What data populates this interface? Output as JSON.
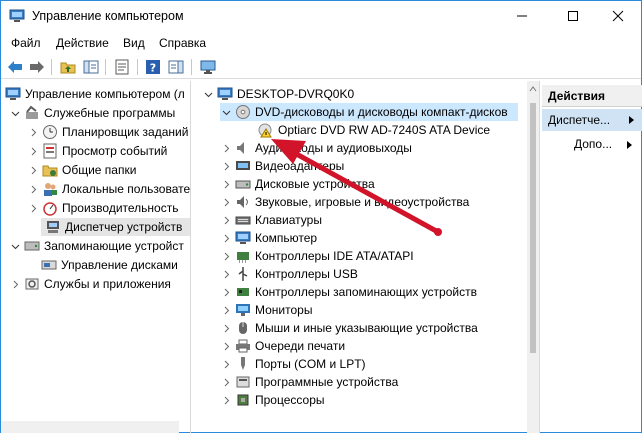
{
  "window": {
    "title": "Управление компьютером",
    "controls": [
      "minimize",
      "maximize",
      "close"
    ]
  },
  "menu": [
    "Файл",
    "Действие",
    "Вид",
    "Справка"
  ],
  "left_tree": {
    "root": "Управление компьютером (л",
    "items": [
      {
        "label": "Служебные программы"
      },
      {
        "label": "Планировщик заданий"
      },
      {
        "label": "Просмотр событий"
      },
      {
        "label": "Общие папки"
      },
      {
        "label": "Локальные пользовате"
      },
      {
        "label": "Производительность"
      },
      {
        "label": "Диспетчер устройств"
      },
      {
        "label": "Запоминающие устройст"
      },
      {
        "label": "Управление дисками"
      },
      {
        "label": "Службы и приложения"
      }
    ]
  },
  "device_tree": {
    "computer": "DESKTOP-DVRQ0K0",
    "categories": [
      {
        "label": "DVD-дисководы и дисководы компакт-дисков"
      },
      {
        "label": "Optiarc DVD RW AD-7240S ATA Device"
      },
      {
        "label": "Аудиовходы и аудиовыходы"
      },
      {
        "label": "Видеоадаптеры"
      },
      {
        "label": "Дисковые устройства"
      },
      {
        "label": "Звуковые, игровые и видеоустройства"
      },
      {
        "label": "Клавиатуры"
      },
      {
        "label": "Компьютер"
      },
      {
        "label": "Контроллеры IDE ATA/ATAPI"
      },
      {
        "label": "Контроллеры USB"
      },
      {
        "label": "Контроллеры запоминающих устройств"
      },
      {
        "label": "Мониторы"
      },
      {
        "label": "Мыши и иные указывающие устройства"
      },
      {
        "label": "Очереди печати"
      },
      {
        "label": "Порты (COM и LPT)"
      },
      {
        "label": "Программные устройства"
      },
      {
        "label": "Процессоры"
      }
    ]
  },
  "actions": {
    "header": "Действия",
    "selected": "Диспетче...",
    "more": "Допо..."
  },
  "colors": {
    "selection": "#cce8ff",
    "arrow": "#d1142a",
    "accent": "#2b8ad9"
  }
}
